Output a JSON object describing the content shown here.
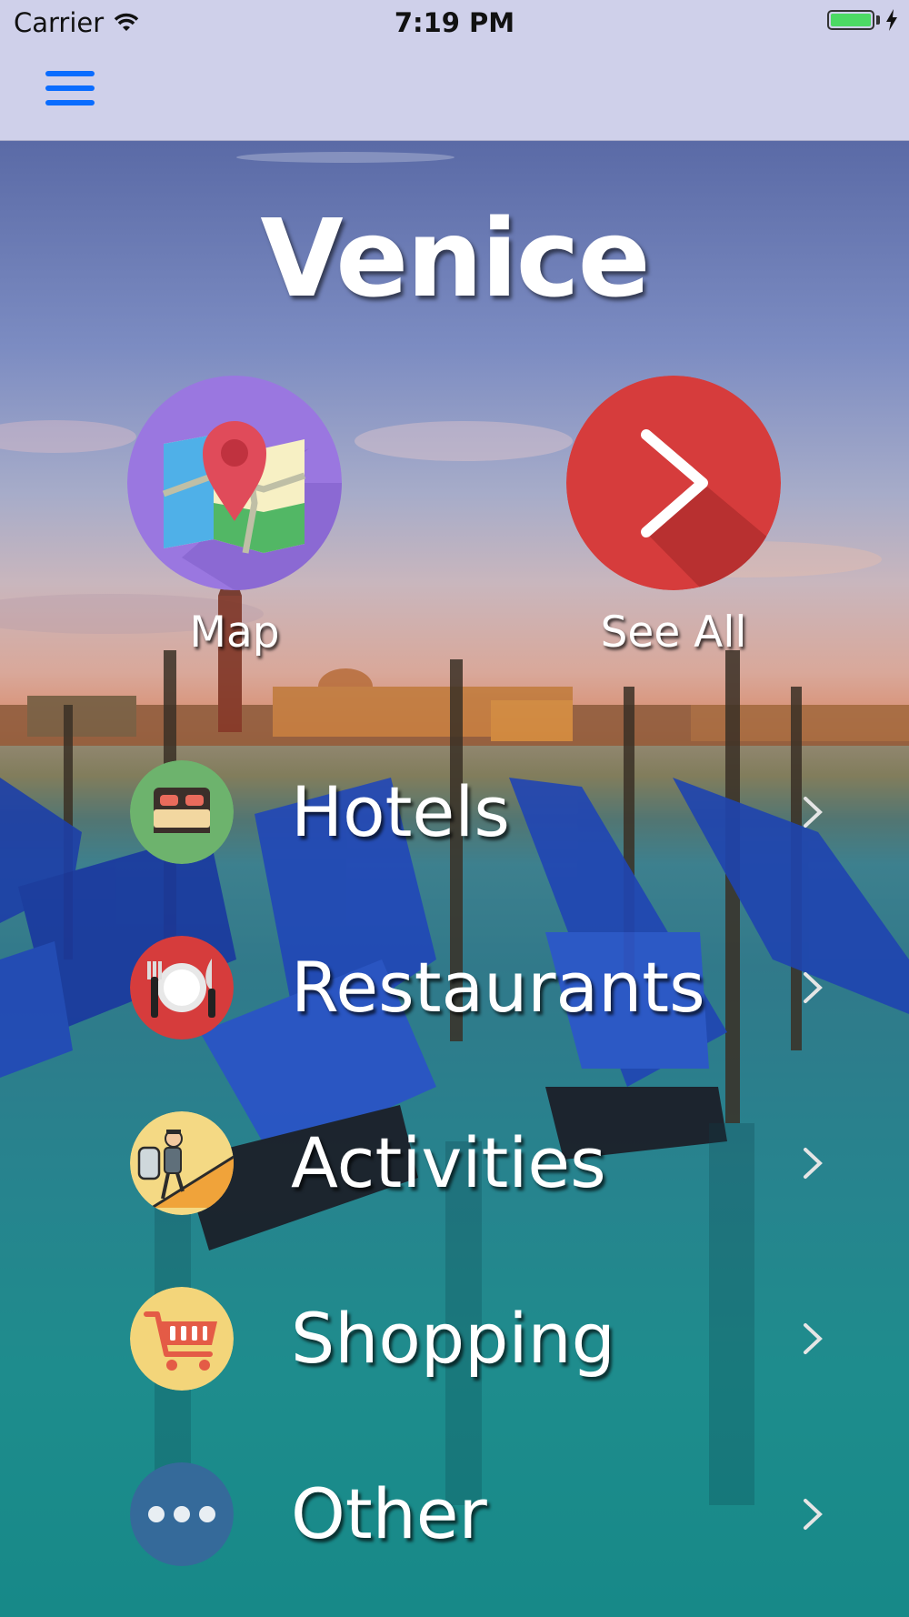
{
  "status_bar": {
    "carrier": "Carrier",
    "time": "7:19 PM"
  },
  "nav": {
    "menu_icon": "hamburger-menu-icon",
    "accent": "#0a6cff"
  },
  "title": "Venice",
  "actions": [
    {
      "label": "Map",
      "icon": "map-pin-icon",
      "color": "#9a77e0"
    },
    {
      "label": "See All",
      "icon": "chevron-right-icon",
      "color": "#d63c3c"
    }
  ],
  "categories": [
    {
      "label": "Hotels",
      "icon": "bed-icon",
      "color": "#6db36d"
    },
    {
      "label": "Restaurants",
      "icon": "plate-cutlery-icon",
      "color": "#d63c3c"
    },
    {
      "label": "Activities",
      "icon": "hiker-icon",
      "color": "#f4d984"
    },
    {
      "label": "Shopping",
      "icon": "shopping-cart-icon",
      "color": "#f3d57a"
    },
    {
      "label": "Other",
      "icon": "more-dots-icon",
      "color": "#356a9a"
    }
  ]
}
